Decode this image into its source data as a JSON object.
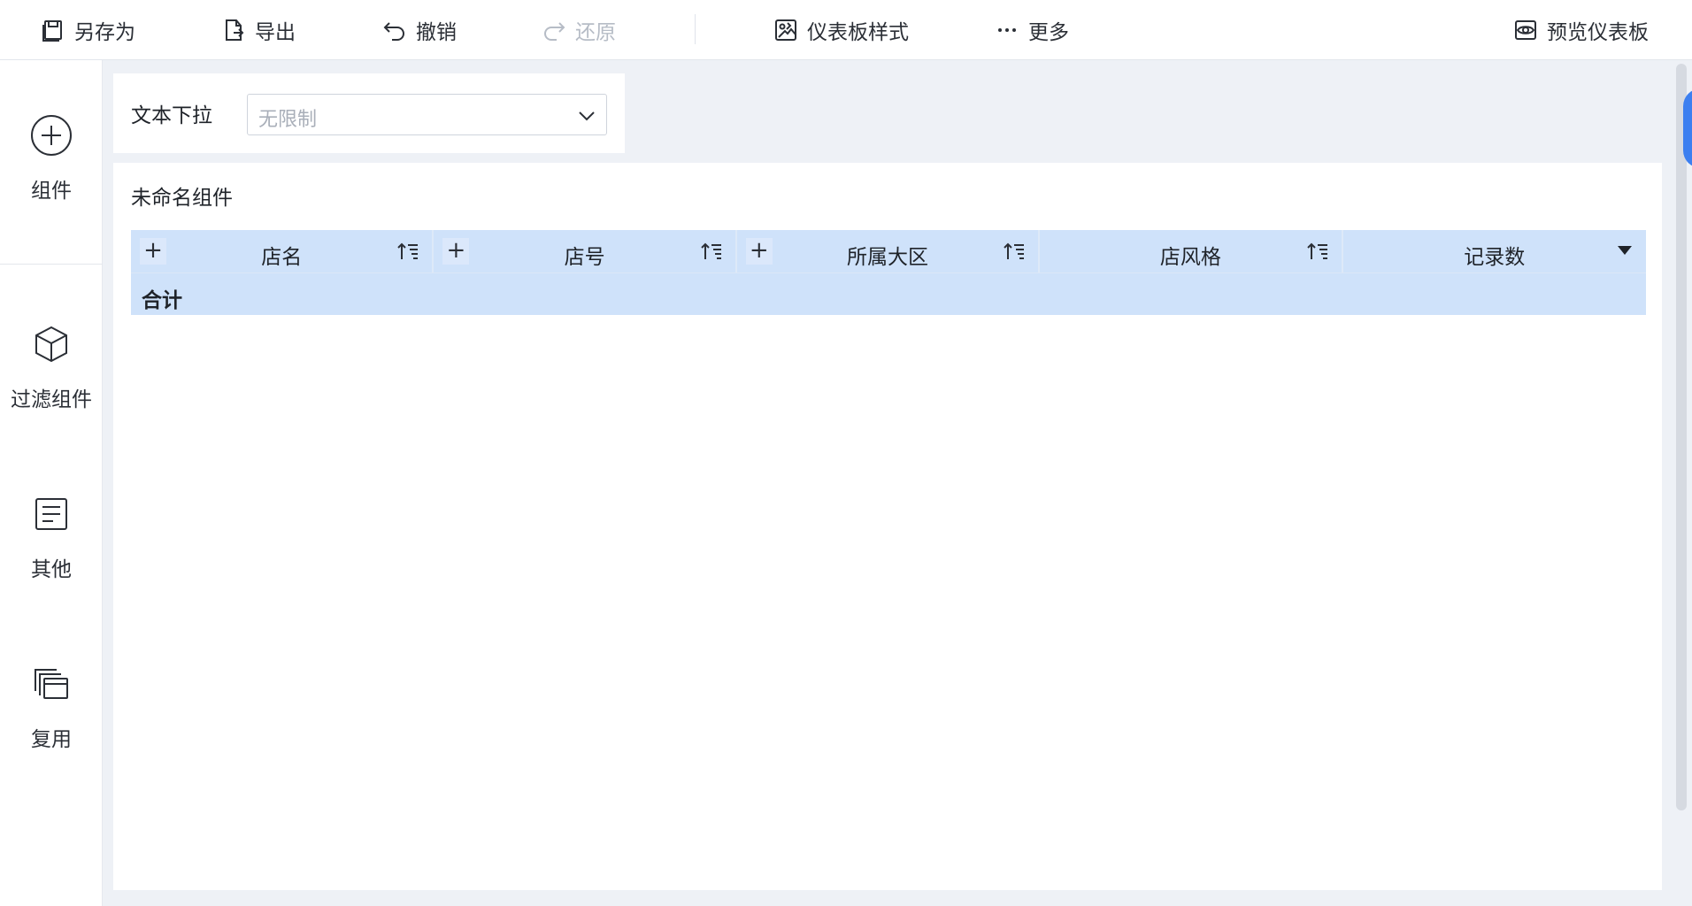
{
  "toolbar": {
    "save_as": "另存为",
    "export": "导出",
    "undo": "撤销",
    "redo": "还原",
    "dashboard_style": "仪表板样式",
    "more": "更多",
    "preview": "预览仪表板"
  },
  "rail": {
    "component": "组件",
    "filter_component": "过滤组件",
    "other": "其他",
    "reuse": "复用"
  },
  "filter": {
    "label": "文本下拉",
    "value": "无限制"
  },
  "component": {
    "title": "未命名组件",
    "columns": [
      {
        "name": "店名",
        "has_plus": true,
        "control": "sort"
      },
      {
        "name": "店号",
        "has_plus": true,
        "control": "sort"
      },
      {
        "name": "所属大区",
        "has_plus": true,
        "control": "sort"
      },
      {
        "name": "店风格",
        "has_plus": false,
        "control": "sort"
      },
      {
        "name": "记录数",
        "has_plus": false,
        "control": "dropdown"
      }
    ],
    "total_label": "合计"
  },
  "colors": {
    "header_bg": "#cfe2fa",
    "accent": "#3c7ff0",
    "disabled": "#b6bcc6"
  }
}
